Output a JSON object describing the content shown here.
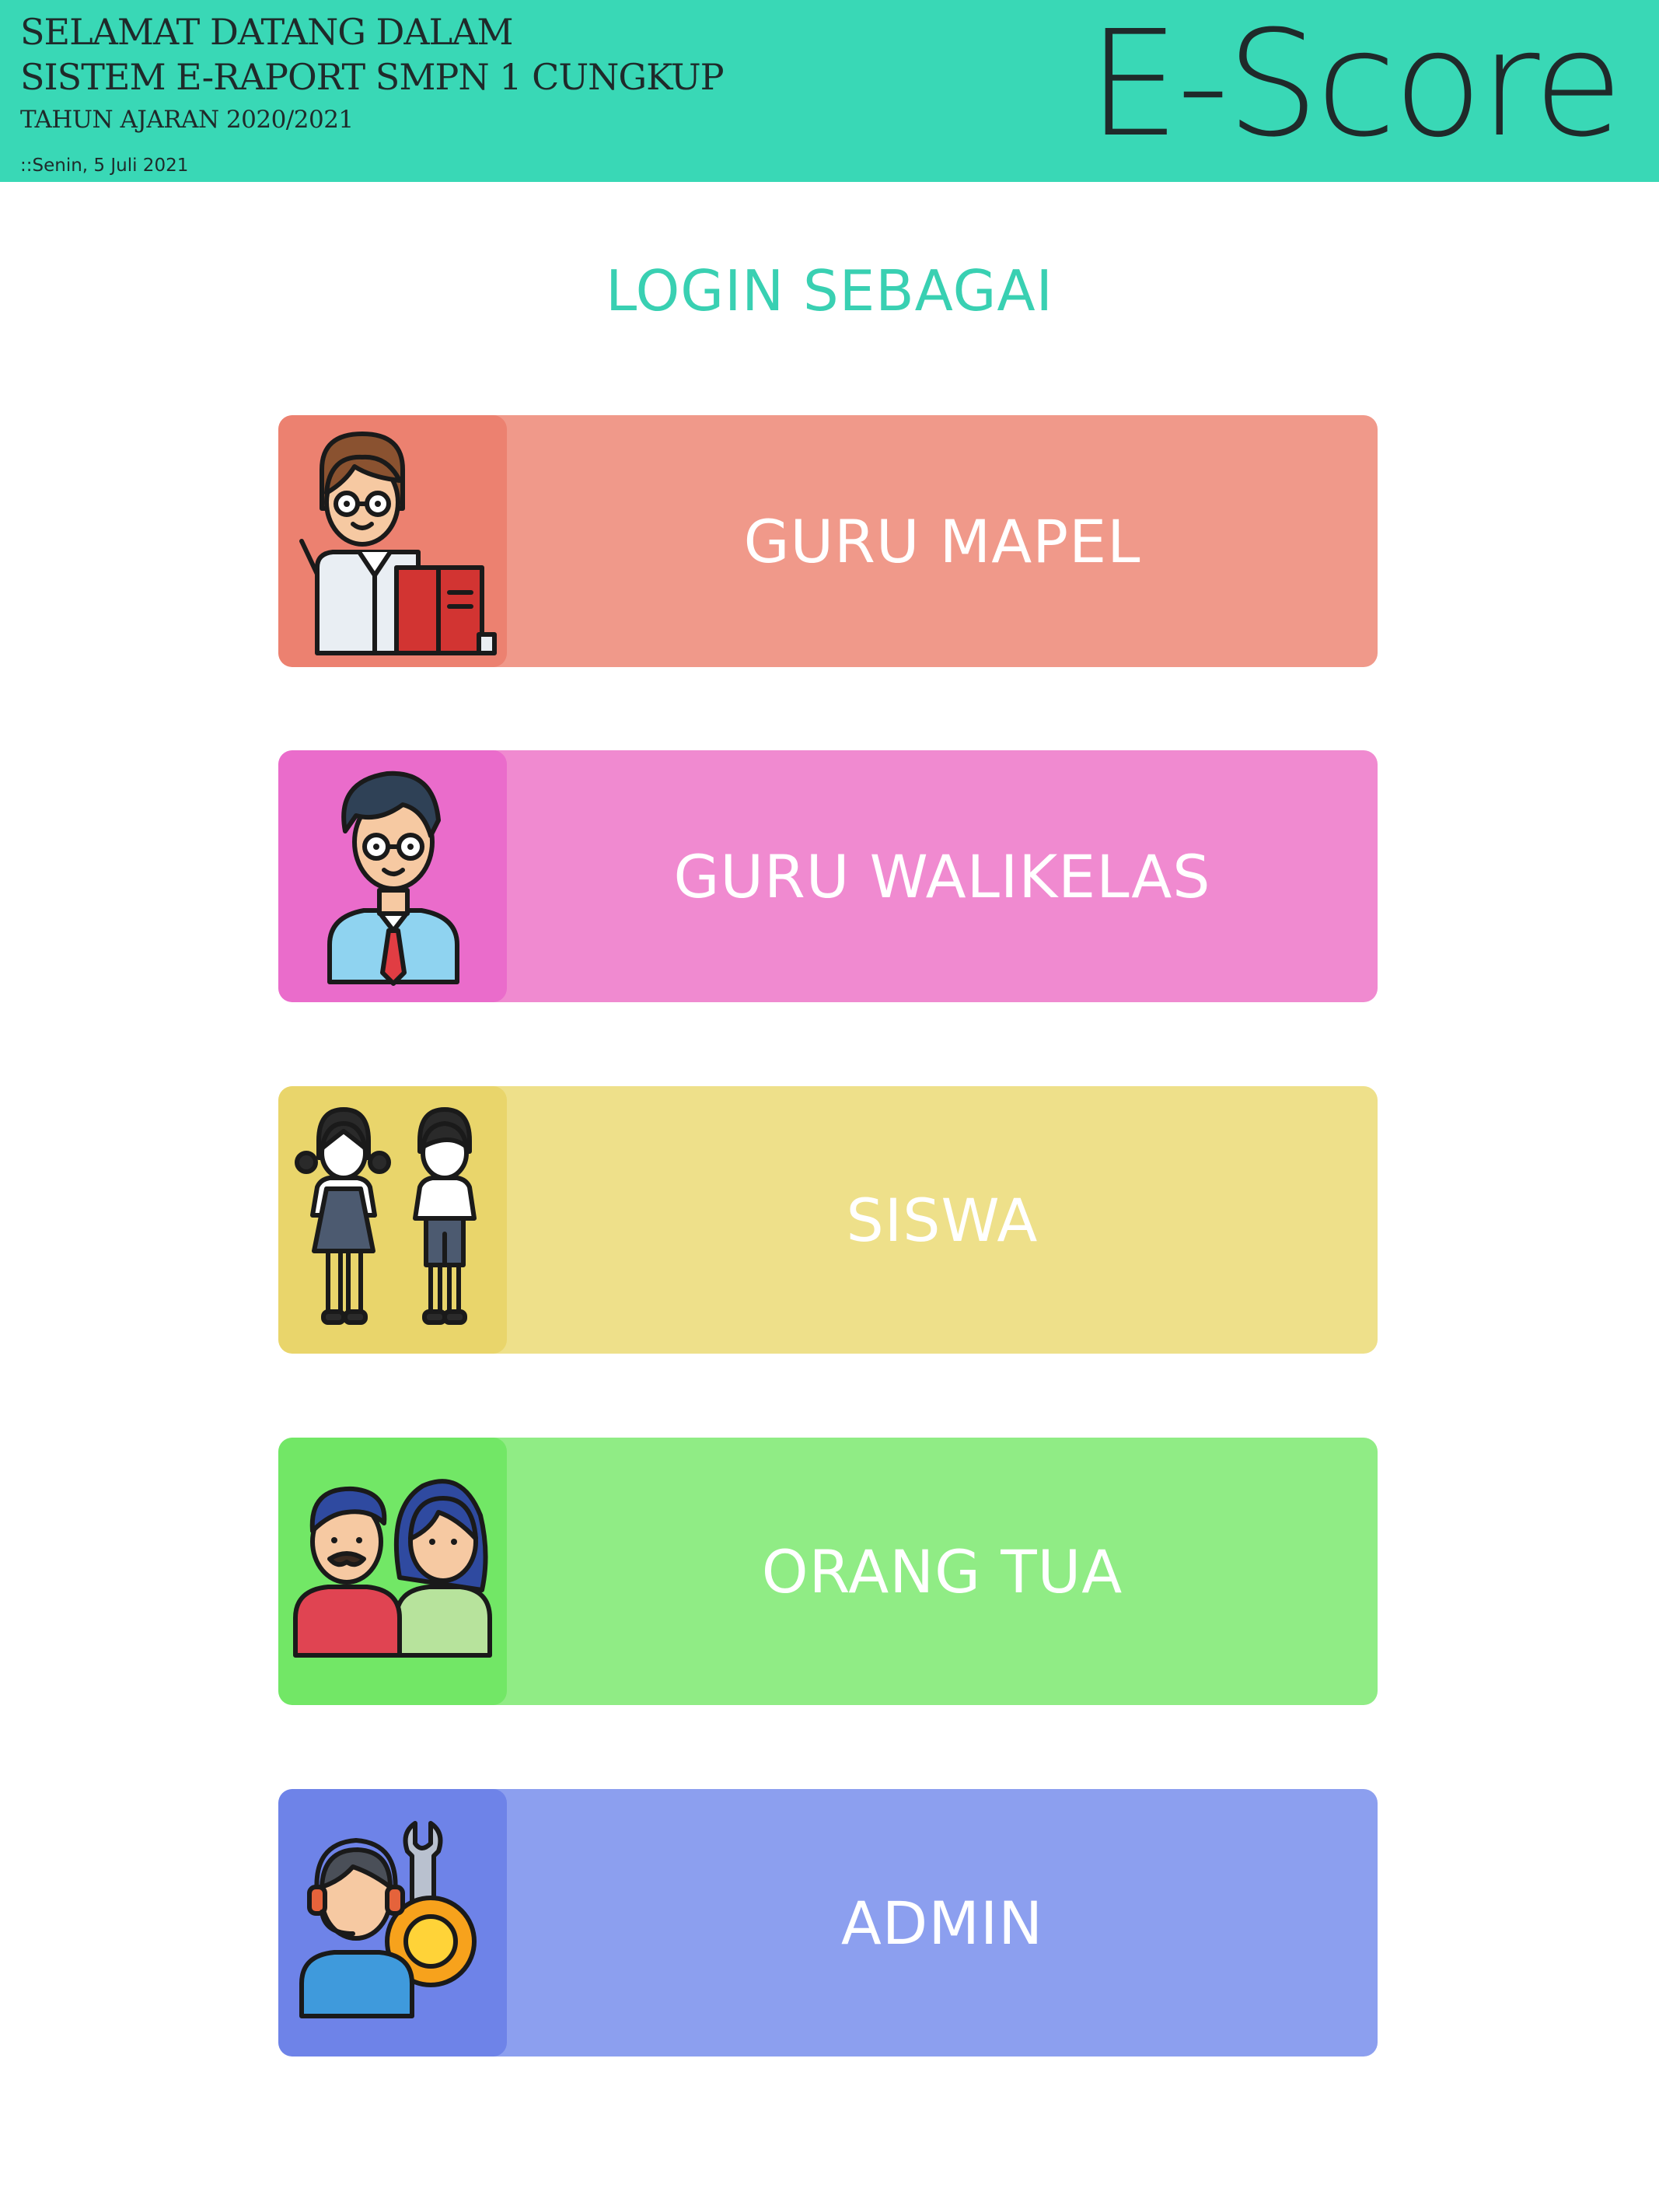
{
  "header": {
    "line1": "SELAMAT DATANG DALAM",
    "line2": "SISTEM E-RAPORT SMPN 1 CUNGKUP",
    "line3": "TAHUN AJARAN 2020/2021",
    "date": "::Senin, 5 Juli 2021",
    "brand": "E-Score"
  },
  "login": {
    "title": "LOGIN SEBAGAI"
  },
  "roles": [
    {
      "label": "GURU MAPEL",
      "icon": "teacher-icon",
      "color": "#f0998a"
    },
    {
      "label": "GURU WALIKELAS",
      "icon": "homeroom-teacher-icon",
      "color": "#f08ad0"
    },
    {
      "label": "SISWA",
      "icon": "students-icon",
      "color": "#eee08a"
    },
    {
      "label": "ORANG TUA",
      "icon": "parents-icon",
      "color": "#90ec85"
    },
    {
      "label": "ADMIN",
      "icon": "admin-icon",
      "color": "#8c9fef"
    }
  ],
  "colors": {
    "header_bg": "#39d8b6",
    "title": "#39d0b2"
  }
}
